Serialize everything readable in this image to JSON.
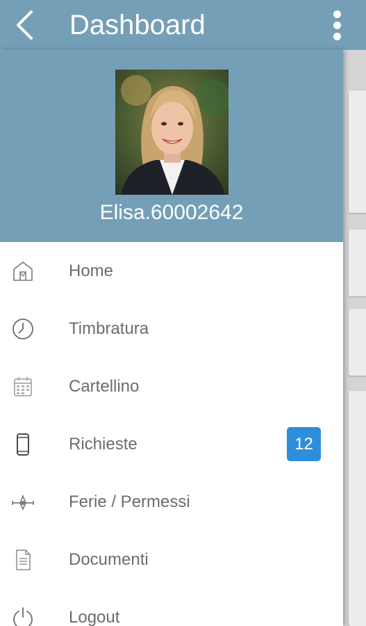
{
  "header": {
    "title": "Dashboard",
    "back_icon": "chevron-left-icon",
    "more_icon": "more-vertical-icon"
  },
  "profile": {
    "username": "Elisa.60002642"
  },
  "menu": {
    "items": [
      {
        "label": "Home",
        "icon": "home-icon"
      },
      {
        "label": "Timbratura",
        "icon": "clock-icon"
      },
      {
        "label": "Cartellino",
        "icon": "calendar-icon"
      },
      {
        "label": "Richieste",
        "icon": "smartphone-icon",
        "badge": "12"
      },
      {
        "label": "Ferie / Permessi",
        "icon": "airplane-icon"
      },
      {
        "label": "Documenti",
        "icon": "document-icon"
      },
      {
        "label": "Logout",
        "icon": "power-icon"
      }
    ]
  },
  "colors": {
    "header": "#759fb7",
    "badge": "#2e8edb",
    "menu_text": "#6c6c6c"
  }
}
